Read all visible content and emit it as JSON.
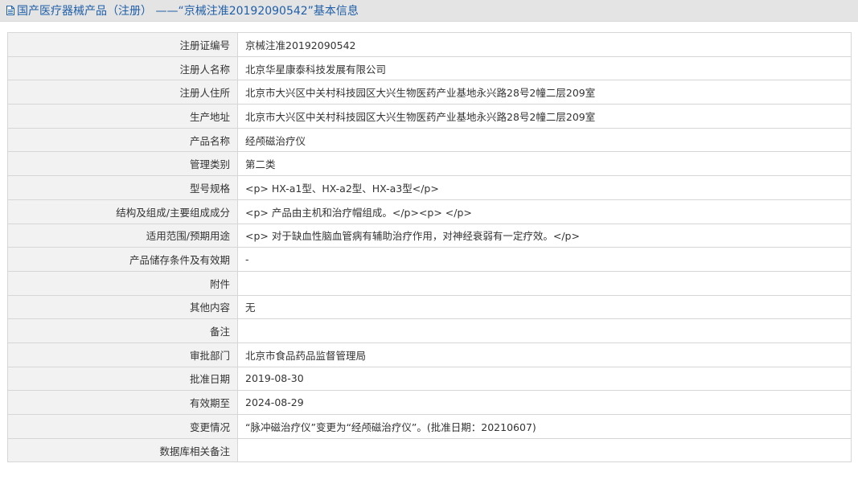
{
  "header": {
    "title": "国产医疗器械产品（注册） ——“京械注准20192090542”基本信息",
    "icon": "document-icon",
    "color": "#1f5fa8"
  },
  "rows": [
    {
      "label": "注册证编号",
      "value": "京械注准20192090542"
    },
    {
      "label": "注册人名称",
      "value": "北京华星康泰科技发展有限公司"
    },
    {
      "label": "注册人住所",
      "value": "北京市大兴区中关村科技园区大兴生物医药产业基地永兴路28号2幢二层209室"
    },
    {
      "label": "生产地址",
      "value": "北京市大兴区中关村科技园区大兴生物医药产业基地永兴路28号2幢二层209室"
    },
    {
      "label": "产品名称",
      "value": "经颅磁治疗仪"
    },
    {
      "label": "管理类别",
      "value": "第二类"
    },
    {
      "label": "型号规格",
      "value": "<p> HX-a1型、HX-a2型、HX-a3型</p>"
    },
    {
      "label": "结构及组成/主要组成成分",
      "value": "<p> 产品由主机和治疗帽组成。</p><p> </p>"
    },
    {
      "label": "适用范围/预期用途",
      "value": "<p> 对于缺血性脑血管病有辅助治疗作用，对神经衰弱有一定疗效。</p>"
    },
    {
      "label": "产品储存条件及有效期",
      "value": "-"
    },
    {
      "label": "附件",
      "value": ""
    },
    {
      "label": "其他内容",
      "value": "无"
    },
    {
      "label": "备注",
      "value": ""
    },
    {
      "label": "审批部门",
      "value": "北京市食品药品监督管理局"
    },
    {
      "label": "批准日期",
      "value": "2019-08-30"
    },
    {
      "label": "有效期至",
      "value": "2024-08-29"
    },
    {
      "label": "变更情况",
      "value": "“脉冲磁治疗仪”变更为“经颅磁治疗仪”。(批准日期：20210607)"
    },
    {
      "label": "数据库相关备注",
      "value": ""
    }
  ]
}
